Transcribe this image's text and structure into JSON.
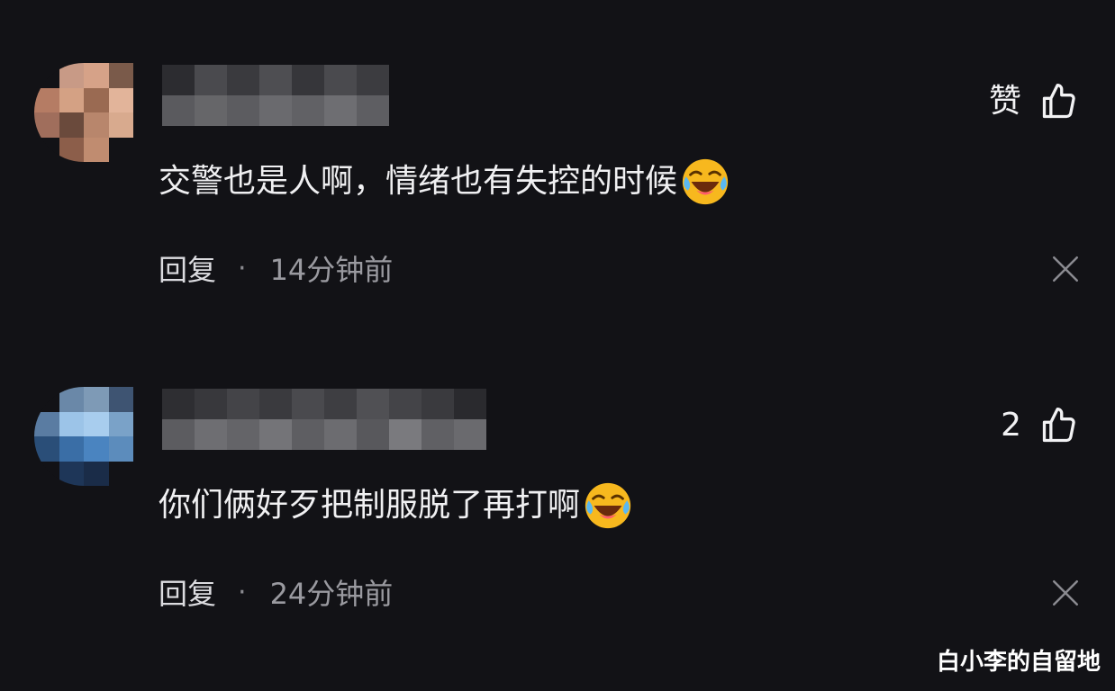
{
  "colors": {
    "background": "#121216",
    "text_primary": "#f0f0f2",
    "text_secondary": "#9a9aa0",
    "emoji_face": "#f7b81e"
  },
  "comments": [
    {
      "like_label": "赞",
      "text": "交警也是人啊，情绪也有失控的时候",
      "emoji": "laughing-crying-emoji",
      "reply_label": "回复",
      "separator": "·",
      "time": "14分钟前",
      "avatar_pixels": [
        "#121216",
        "#c89a86",
        "#d6a288",
        "#7a5a4a",
        "#b57c64",
        "#d4a184",
        "#9a6a52",
        "#e2b49a",
        "#a06e5c",
        "#6a4a3c",
        "#b8866c",
        "#d8aa8e",
        "#121216",
        "#8c5e4a",
        "#c08c70",
        "#121216"
      ],
      "name_pixels": [
        "#2c2c30",
        "#4a4a4e",
        "#3a3a3e",
        "#4e4e52",
        "#36363a",
        "#4a4a4e",
        "#3c3c40",
        "#5a5a5e",
        "#666669",
        "#5c5c60",
        "#6a6a6e",
        "#616165",
        "#6e6e72",
        "#5e5e62"
      ]
    },
    {
      "like_label": "2",
      "text": "你们俩好歹把制服脱了再打啊",
      "emoji": "laughing-crying-emoji",
      "reply_label": "回复",
      "separator": "·",
      "time": "24分钟前",
      "avatar_pixels": [
        "#121216",
        "#6a88a8",
        "#7e9ab6",
        "#3e5472",
        "#5a7ca2",
        "#9cc4e8",
        "#a8cdee",
        "#7aa2c8",
        "#2a4e78",
        "#3a6ea6",
        "#4a84c0",
        "#5c8cbc",
        "#121216",
        "#1e3658",
        "#1a2c48",
        "#121216"
      ],
      "name_pixels": [
        "#2e2e32",
        "#38383c",
        "#444448",
        "#3a3a3e",
        "#4a4a4e",
        "#3e3e42",
        "#505054",
        "#444448",
        "#3a3a3e",
        "#2a2a2e",
        "#5c5c60",
        "#6e6e72",
        "#646468",
        "#747478",
        "#5e5e62",
        "#6c6c70",
        "#58585c",
        "#7a7a7e",
        "#606064",
        "#6a6a6e"
      ]
    }
  ],
  "watermark": "白小李的自留地"
}
